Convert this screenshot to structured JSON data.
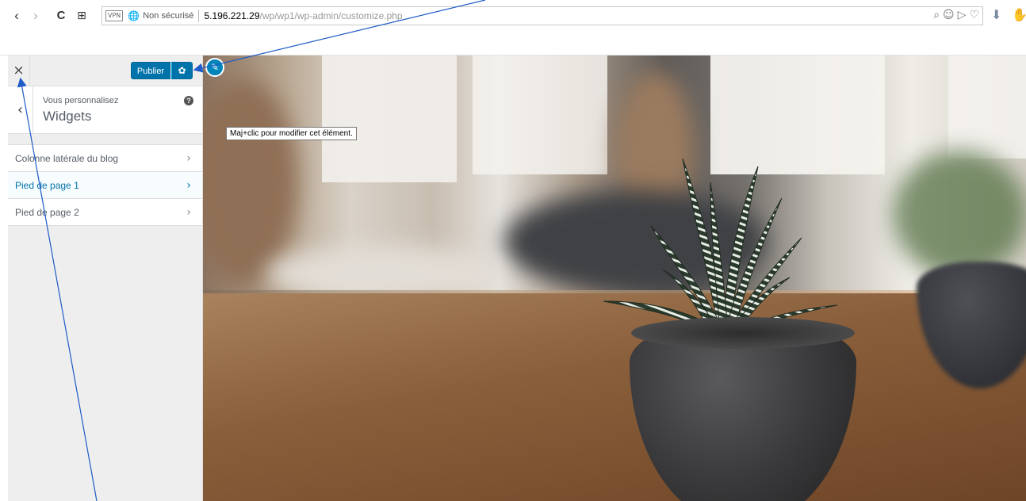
{
  "browser": {
    "back_icon": "‹",
    "forward_icon": "›",
    "reload_icon": "C",
    "apps_icon": "⊞",
    "vpn_badge": "VPN",
    "security_label": "Non sécurisé",
    "url_host": "5.196.221.29",
    "url_path": "/wp/wp1/wp-admin/customize.php"
  },
  "customizer": {
    "close_icon": "×",
    "publish_label": "Publier",
    "settings_icon": "✿",
    "back_icon": "‹",
    "subtitle": "Vous personnalisez",
    "title": "Widgets",
    "help_icon": "?",
    "sections": [
      {
        "label": "Colonne latérale du blog",
        "active": false
      },
      {
        "label": "Pied de page 1",
        "active": true
      },
      {
        "label": "Pied de page 2",
        "active": false
      }
    ],
    "chevron": "›"
  },
  "preview": {
    "edit_icon": "✎",
    "tooltip": "Maj+clic pour modifier cet élément."
  },
  "colors": {
    "accent": "#0073aa",
    "annotation": "#1e5bc6"
  }
}
